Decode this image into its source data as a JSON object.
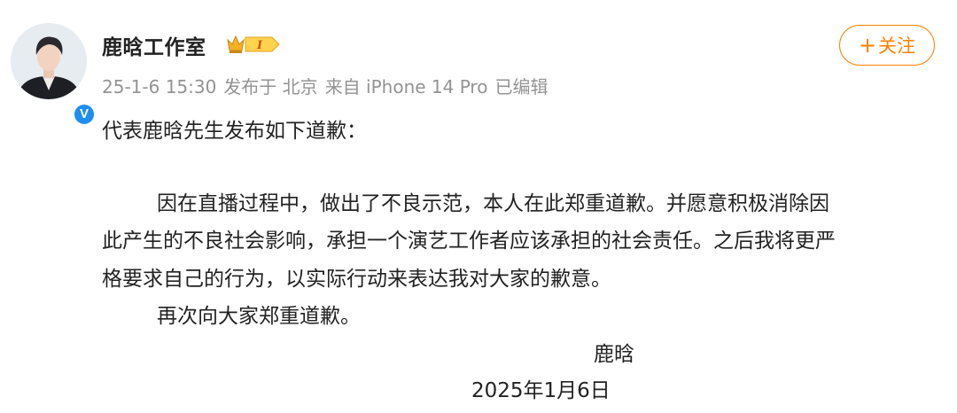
{
  "post": {
    "author_name": "鹿晗工作室",
    "timestamp": "25-1-6 15:30",
    "publish_location": "发布于 北京",
    "source": "来自 iPhone 14 Pro",
    "edited": "已编辑",
    "follow_label": "关注",
    "follow_icon": "+",
    "level_badge_text": "I",
    "verified_icon": "V",
    "lines": [
      "代表鹿晗先生发布如下道歉：",
      "因在直播过程中，做出了不良示范，本人在此郑重道歉。并愿意积极消除因",
      "此产生的不良社会影响，承担一个演艺工作者应该承担的社会责任。之后我将更严",
      "格要求自己的行为，以实际行动来表达我对大家的歉意。",
      "再次向大家郑重道歉。",
      "鹿晗",
      "2025年1月6日"
    ]
  },
  "colors": {
    "accent": "#ff8200",
    "verified": "#1f8ef1",
    "meta": "#939393",
    "badge_gold": "#f5b324"
  }
}
